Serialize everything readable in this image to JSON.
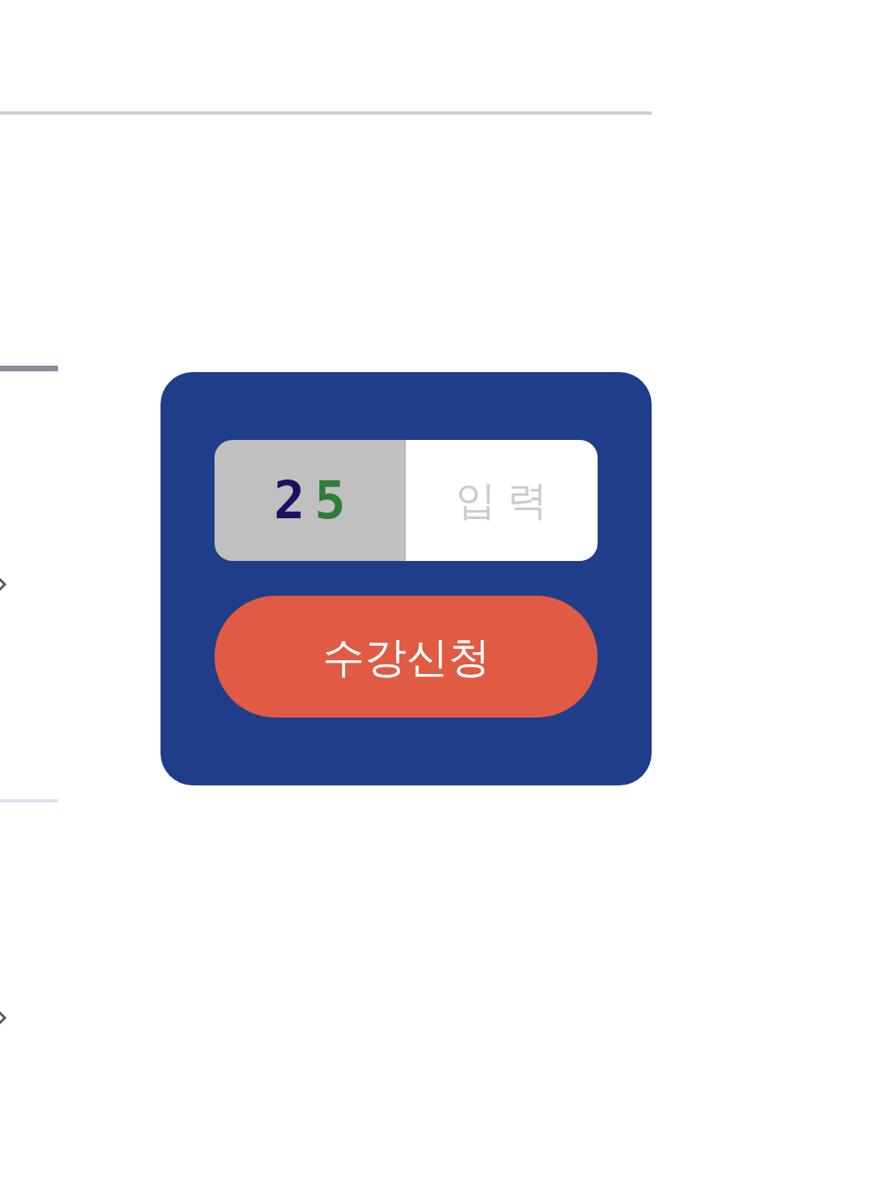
{
  "captcha": {
    "digits": [
      {
        "text": "2",
        "color": "#1e1060"
      },
      {
        "text": "5",
        "color": "#2e7d3a"
      }
    ]
  },
  "code_field": {
    "placeholder": "입 력"
  },
  "apply_button": {
    "label": "수강신청"
  }
}
